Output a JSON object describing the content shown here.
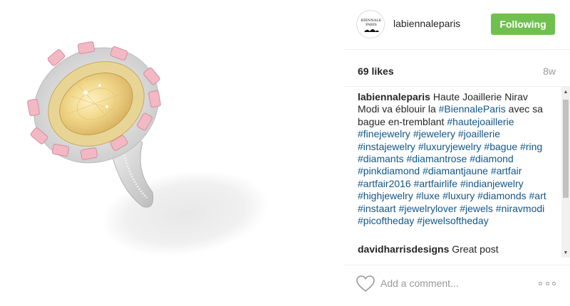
{
  "post": {
    "username": "labiennaleparis",
    "follow_label": "Following",
    "likes": "69 likes",
    "age": "8w",
    "avatar_text": "BIENNALE PARIS"
  },
  "caption": {
    "username": "labiennaleparis",
    "text_1": " Haute Joaillerie Nirav Modi va éblouir la ",
    "tag_biennale": "#BiennaleParis",
    "text_2": " avec sa bague en-tremblant ",
    "hashtags": [
      "#hautejoaillerie",
      "#finejewelry",
      "#jewelery",
      "#joaillerie",
      "#instajewelry",
      "#luxuryjewelry",
      "#bague",
      "#ring",
      "#diamants",
      "#diamantrose",
      "#diamond",
      "#pinkdiamond",
      "#diamantjaune",
      "#artfair",
      "#artfair2016",
      "#artfairlife",
      "#indianjewelry",
      "#highjewelry",
      "#luxe",
      "#luxury",
      "#diamonds",
      "#art",
      "#instaart",
      "#jewelrylover",
      "#jewels",
      "#niravmodi",
      "#picoftheday",
      "#jewelsoftheday"
    ]
  },
  "comments": [
    {
      "username": "davidharrisdesigns",
      "text": " Great post"
    }
  ],
  "footer": {
    "comment_placeholder": "Add a comment...",
    "heart_icon": "heart-outline-icon",
    "more_icon": "more-options-icon"
  },
  "colors": {
    "follow_green": "#70c050",
    "hashtag_blue": "#125688",
    "muted_gray": "#999999",
    "text": "#262626"
  }
}
